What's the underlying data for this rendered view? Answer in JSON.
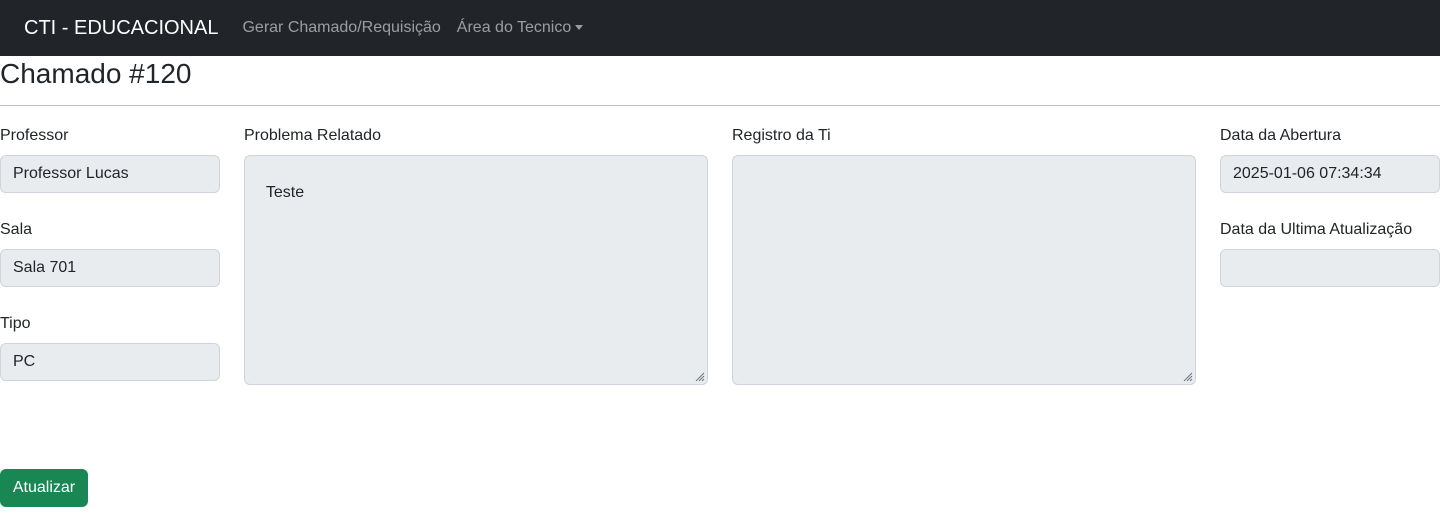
{
  "navbar": {
    "brand": "CTI - EDUCACIONAL",
    "links": [
      {
        "label": "Gerar Chamado/Requisição"
      },
      {
        "label": "Área do Tecnico",
        "dropdown": true
      }
    ]
  },
  "page": {
    "title": "Chamado #120"
  },
  "form": {
    "professor": {
      "label": "Professor",
      "value": "Professor Lucas"
    },
    "sala": {
      "label": "Sala",
      "value": "Sala 701"
    },
    "tipo": {
      "label": "Tipo",
      "value": "PC"
    },
    "problema": {
      "label": "Problema Relatado",
      "value": "Teste"
    },
    "registro": {
      "label": "Registro da Ti",
      "value": ""
    },
    "data_abertura": {
      "label": "Data da Abertura",
      "value": "2025-01-06 07:34:34"
    },
    "data_atualizacao": {
      "label": "Data da Ultima Atualização",
      "value": ""
    }
  },
  "actions": {
    "update_label": "Atualizar"
  },
  "colors": {
    "navbar_bg": "#212529",
    "field_bg": "#e9ecef",
    "button_success": "#198754"
  }
}
